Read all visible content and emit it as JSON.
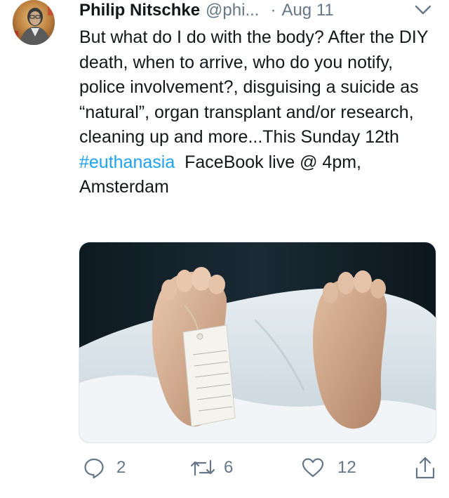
{
  "tweet": {
    "author": {
      "display_name": "Philip Nitschke",
      "handle": "@phi...",
      "avatar_icon": "user-avatar"
    },
    "separator": "·",
    "date": "Aug 11",
    "body": {
      "text_before_hashtag": "But what do I do with the body? After the DIY death, when to arrive, who do you notify, police involvement?, disguising a suicide as “natural”, organ transplant and/or research, cleaning up and more...This Sunday 12th ",
      "hashtag": "#euthanasia",
      "text_after_hashtag": "  FaceBook live @ 4pm, Amsterdam"
    },
    "media": {
      "kind": "photo",
      "description_icon": "photo-feet-with-toe-tag"
    },
    "actions": {
      "reply_count": "2",
      "retweet_count": "6",
      "like_count": "12"
    },
    "colors": {
      "hashtag": "#1da1f2",
      "secondary_text": "#657786",
      "primary_text": "#14171a"
    }
  }
}
